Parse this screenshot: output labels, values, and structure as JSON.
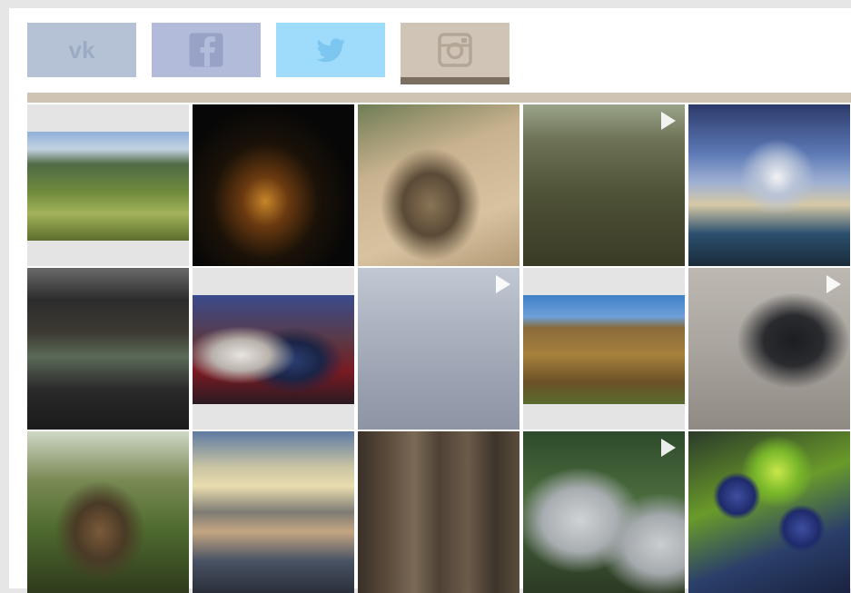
{
  "social_tabs": [
    {
      "id": "vk",
      "icon": "vk-icon",
      "bg": "#b5c2d6",
      "fg": "#9aabc3",
      "active": false
    },
    {
      "id": "facebook",
      "icon": "facebook-icon",
      "bg": "#b2bbd9",
      "fg": "#97a2c6",
      "active": false
    },
    {
      "id": "twitter",
      "icon": "twitter-icon",
      "bg": "#9fdcfc",
      "fg": "#7cc6ef",
      "active": false
    },
    {
      "id": "instagram",
      "icon": "instagram-icon",
      "bg": "#cfc4b6",
      "fg": "#b3a696",
      "active": true
    }
  ],
  "colors": {
    "accent_bar": "#cfc3b4",
    "active_indicator": "#7c6f60"
  },
  "photos": [
    {
      "name": "mountain-valley-photo",
      "crop": "landscape",
      "video": false,
      "bg": "linear-gradient(180deg,#8fb0d8 0%,#c3d2e2 16%,#4f6a45 30%,#6f8a3c 55%,#a2b35a 75%,#5c6e2d 100%)"
    },
    {
      "name": "night-city-photo",
      "crop": "full",
      "video": false,
      "bg": "radial-gradient(ellipse at 45% 60%,#c7862a 0%,#6b3a10 18%,#1b1208 42%,#070707 70%)"
    },
    {
      "name": "tortoise-photo",
      "crop": "full",
      "video": false,
      "bg": "radial-gradient(ellipse at 45% 62%,#8a7456 0%,#5a4a36 22%,transparent 40%),linear-gradient(160deg,#6f7d55 0%,#c9b28f 35%,#d8c3a1 70%,#b59b77 100%)"
    },
    {
      "name": "underwater-photo",
      "crop": "full",
      "video": true,
      "bg": "linear-gradient(180deg,#9aa38a 0%,#6e7356 22%,#4e5236 55%,#3a3b26 100%)"
    },
    {
      "name": "opera-house-photo",
      "crop": "full",
      "video": false,
      "bg": "radial-gradient(ellipse at 55% 45%,#f2f2f2 0%,#b9c4d8 14%,transparent 30%),linear-gradient(180deg,#2c3a6a 0%,#5c79b5 30%,#9eb0d3 48%,#d6c9a6 62%,#2b4f6e 80%,#1b2c3a 100%)"
    },
    {
      "name": "gallery-hall-photo",
      "crop": "full",
      "video": false,
      "bg": "linear-gradient(180deg,#6a6a6a 0%,#2c2c2c 20%,#3d3a32 40%,#5b6a58 55%,#2a2a2a 75%,#1a1a1a 100%)"
    },
    {
      "name": "llama-woman-photo",
      "crop": "landscape",
      "video": false,
      "bg": "radial-gradient(ellipse at 30% 55%,#e8e4e0 0%,#b9b2ac 18%,transparent 34%),radial-gradient(ellipse at 62% 60%,#2b3f73 0%,#1a2446 20%,transparent 36%),linear-gradient(180deg,#3a4b8c 0%,#5a3a48 40%,#7a1a22 70%,#2a1a22 100%)"
    },
    {
      "name": "snow-stick-photo",
      "crop": "full",
      "video": true,
      "bg": "linear-gradient(180deg,#c2c8d3 0%,#aab1be 40%,#9aa2b1 70%,#8d95a4 100%)"
    },
    {
      "name": "wooden-sign-photo",
      "crop": "landscape",
      "video": false,
      "bg": "linear-gradient(180deg,#3f80c8 0%,#6ea0d8 20%,#8a6a3a 30%,#a6813d 55%,#6b5127 80%,#5a6b2d 100%)"
    },
    {
      "name": "heron-photo",
      "crop": "full",
      "video": true,
      "bg": "radial-gradient(ellipse at 65% 45%,#1c1d20 0%,#2a2b2f 20%,transparent 38%),linear-gradient(180deg,#bdb8b2 0%,#a9a49e 50%,#8f8a83 100%)"
    },
    {
      "name": "monkey-tree-photo",
      "crop": "full",
      "video": false,
      "bg": "radial-gradient(ellipse at 45% 62%,#7a5a3a 0%,#4a3a26 20%,transparent 36%),linear-gradient(180deg,#cfd8c6 0%,#7a8a55 30%,#4f6b2f 60%,#2e3a1c 100%)"
    },
    {
      "name": "sunset-lake-photo",
      "crop": "full",
      "video": false,
      "bg": "linear-gradient(180deg,#5f7aa3 0%,#c9c4a3 22%,#e9dcae 34%,#7d7b74 50%,#c5a682 62%,#4a5365 80%,#2a2f3a 100%)"
    },
    {
      "name": "forest-photo",
      "crop": "full",
      "video": false,
      "bg": "linear-gradient(90deg,#3a3028 0%,#5a4a3a 18%,#7b6a56 35%,#4e4236 50%,#6b5b4a 68%,#3d342a 85%,#5b4d3d 100%)"
    },
    {
      "name": "stone-pillar-photo",
      "crop": "full",
      "video": true,
      "bg": "radial-gradient(ellipse at 35% 55%,#cfd3d5 0%,#a8adb1 25%,transparent 42%),radial-gradient(ellipse at 85% 70%,#c9cdd0 0%,#a5aaae 18%,transparent 32%),linear-gradient(180deg,#2d4a2a 0%,#4a6b3d 40%,#2c3a24 100%)"
    },
    {
      "name": "berries-photo",
      "crop": "full",
      "video": false,
      "bg": "radial-gradient(circle at 30% 40%,#3e4fa0 0%,#1e2a6a 12%,transparent 16%),radial-gradient(circle at 70% 60%,#3e4fa0 0%,#1e2a6a 12%,transparent 16%),radial-gradient(circle at 55% 25%,#c8e84a 0%,#7ab82a 14%,transparent 24%),linear-gradient(160deg,#2a3a2a 0%,#6a9a2a 40%,#2a3f6a 70%,#1a2240 100%)"
    }
  ]
}
